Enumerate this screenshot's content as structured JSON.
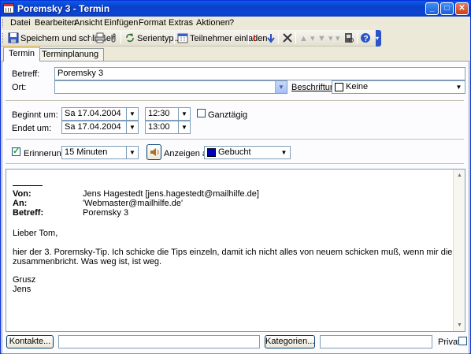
{
  "window": {
    "title": "Poremsky 3 - Termin"
  },
  "menu": [
    "Datei",
    "Bearbeiten",
    "Ansicht",
    "Einfügen",
    "Format",
    "Extras",
    "Aktionen",
    "?"
  ],
  "toolbar": {
    "save_close": "Speichern und schließen",
    "recurrence": "Serientyp...",
    "invite": "Teilnehmer einladen"
  },
  "tabs": [
    "Termin",
    "Terminplanung"
  ],
  "form": {
    "subject_label": "Betreff:",
    "subject_value": "Poremsky 3",
    "location_label": "Ort:",
    "location_value": "",
    "label_label": "Beschriftung:",
    "label_value": "Keine",
    "start_label": "Beginnt um:",
    "start_date": "Sa 17.04.2004",
    "start_time": "12:30",
    "allday_label": "Ganztägig",
    "end_label": "Endet um:",
    "end_date": "Sa 17.04.2004",
    "end_time": "13:00",
    "reminder_label": "Erinnerung:",
    "reminder_value": "15 Minuten",
    "showas_label": "Anzeigen als:",
    "showas_value": "Gebucht",
    "showas_color": "#0000c0"
  },
  "message": {
    "from_label": "Von:",
    "from_value": "Jens Hagestedt [jens.hagestedt@mailhilfe.de]",
    "to_label": "An:",
    "to_value": "'Webmaster@mailhilfe.de'",
    "subject_label": "Betreff:",
    "subject_value": "Poremsky 3",
    "greeting": "Lieber Tom,",
    "line1": "hier der 3. Poremsky-Tip. Ich schicke die Tips einzeln, damit ich nicht alles von neuem schicken muß, wenn mir die Leitung",
    "line2": "zusammenbricht. Was weg ist, ist weg.",
    "closing": "Grusz",
    "signature": "Jens"
  },
  "footer": {
    "contacts_button": "Kontakte...",
    "contacts_value": "",
    "categories_button": "Kategorien...",
    "categories_value": "",
    "private_label": "Privat"
  }
}
